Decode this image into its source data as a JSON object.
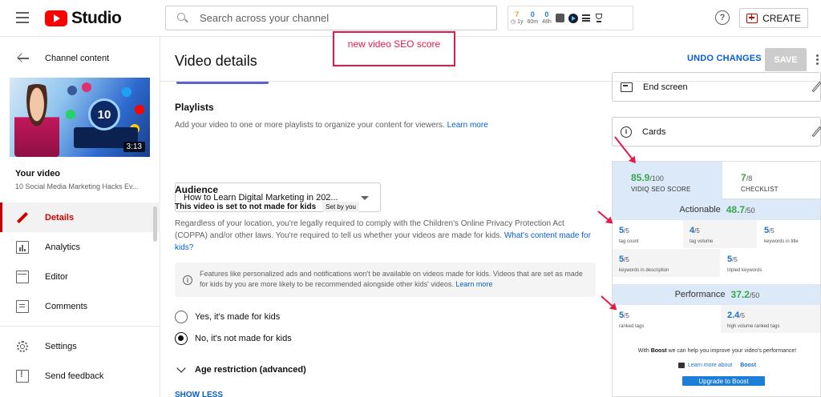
{
  "topbar": {
    "logo_text": "Studio",
    "search_placeholder": "Search across your channel",
    "stats": [
      {
        "value": "7",
        "label": "1y"
      },
      {
        "value": "0",
        "label": "60m"
      },
      {
        "value": "0",
        "label": "48h"
      }
    ],
    "create_label": "CREATE",
    "help_glyph": "?"
  },
  "sidebar": {
    "back_label": "Channel content",
    "thumbnail_duration": "3:13",
    "thumbnail_badge": "10",
    "your_video_label": "Your video",
    "video_title": "10 Social Media Marketing Hacks Ev...",
    "items": [
      {
        "label": "Details",
        "icon": "pencil-icon",
        "active": true
      },
      {
        "label": "Analytics",
        "icon": "analytics-icon"
      },
      {
        "label": "Editor",
        "icon": "editor-icon"
      },
      {
        "label": "Comments",
        "icon": "comments-icon"
      },
      {
        "label": "Settings",
        "icon": "gear-icon"
      },
      {
        "label": "Send feedback",
        "icon": "feedback-icon"
      }
    ]
  },
  "main": {
    "title": "Video details",
    "annotation": "new video SEO score",
    "undo_label": "UNDO CHANGES",
    "save_label": "SAVE",
    "playlists": {
      "heading": "Playlists",
      "description": "Add your video to one or more playlists to organize your content for viewers.",
      "learn_more": "Learn more",
      "selected": "How to Learn Digital Marketing in 202..."
    },
    "audience": {
      "heading": "Audience",
      "status": "This video is set to not made for kids",
      "chip": "Set by you",
      "body": "Regardless of your location, you're legally required to comply with the Children's Online Privacy Protection Act (COPPA) and/or other laws. You're required to tell us whether your videos are made for kids.",
      "body_link": "What's content made for kids?",
      "info": "Features like personalized ads and notifications won't be available on videos made for kids. Videos that are set as made for kids by you are more likely to be recommended alongside other kids' videos.",
      "info_link": "Learn more",
      "option_yes": "Yes, it's made for kids",
      "option_no": "No, it's not made for kids",
      "selected_option": "no"
    },
    "age_restriction": "Age restriction (advanced)",
    "show_less": "SHOW LESS"
  },
  "right": {
    "end_screen": "End screen",
    "cards": "Cards",
    "seo_panel": {
      "seo_score": "85.9",
      "seo_of": "/100",
      "seo_label": "VIDIQ SEO SCORE",
      "checklist_score": "7",
      "checklist_of": "/8",
      "checklist_label": "CHECKLIST",
      "actionable_label": "Actionable",
      "actionable_score": "48.7",
      "actionable_of": "/50",
      "actionable_items": [
        {
          "value": "5",
          "of": "/5",
          "label": "tag count"
        },
        {
          "value": "4",
          "of": "/5",
          "label": "tag volume"
        },
        {
          "value": "5",
          "of": "/5",
          "label": "keywords in title"
        },
        {
          "value": "5",
          "of": "/5",
          "label": "keywords in description"
        },
        {
          "value": "5",
          "of": "/5",
          "label": "tripled keywords"
        }
      ],
      "performance_label": "Performance",
      "performance_score": "37.2",
      "performance_of": "/50",
      "performance_items": [
        {
          "value": "5",
          "of": "/5",
          "label": "ranked tags"
        },
        {
          "value": "2.4",
          "of": "/5",
          "label": "high volume ranked tags"
        }
      ],
      "boost_prefix": "With",
      "boost_word": "Boost",
      "boost_suffix": "we can help you improve your video's performance!",
      "learn_boost_prefix": "Learn more about",
      "learn_boost_word": "Boost",
      "upgrade_label": "Upgrade to Boost"
    }
  },
  "colors": {
    "accent_red": "#cc0000",
    "link_blue": "#065fd4",
    "annotation_pink": "#e8174a",
    "score_green": "#3aa64b",
    "metric_blue": "#1c6fc9"
  }
}
